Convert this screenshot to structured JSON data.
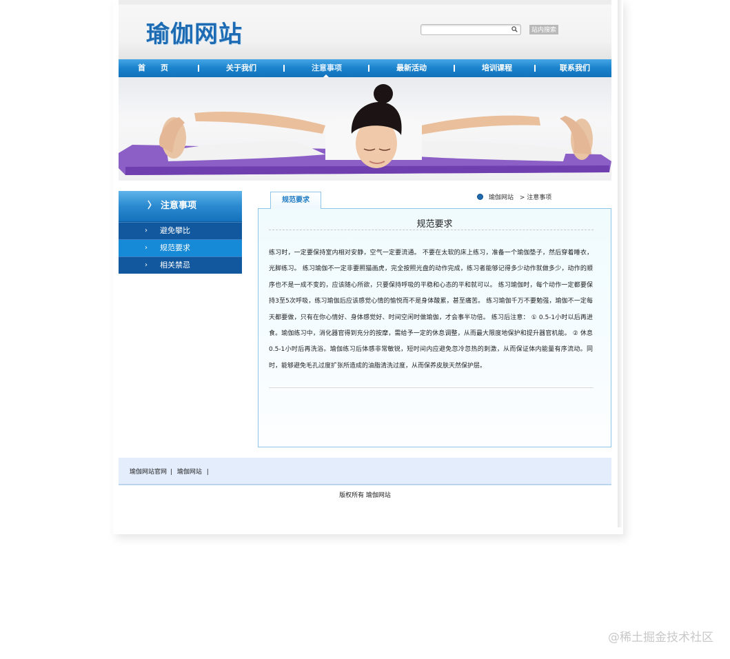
{
  "site": {
    "logo_text": "瑜伽网站",
    "search_placeholder": "",
    "search_button": "站内搜索"
  },
  "nav": {
    "items": [
      {
        "label": "首　　页"
      },
      {
        "label": "关于我们"
      },
      {
        "label": "注意事项"
      },
      {
        "label": "最新活动"
      },
      {
        "label": "培训课程"
      },
      {
        "label": "联系我们"
      }
    ],
    "separator": "|",
    "active_index": 2
  },
  "sidebar": {
    "title": "注意事项",
    "title_chevron": "〉",
    "items": [
      {
        "label": "避免攀比",
        "active": false
      },
      {
        "label": "规范要求",
        "active": true
      },
      {
        "label": "相关禁忌",
        "active": false
      }
    ]
  },
  "main": {
    "tab_label": "规范要求",
    "breadcrumb": {
      "home": "瑜伽网站",
      "current": "> 注意事项"
    },
    "title": "规范要求",
    "article": "练习时，一定要保持室内相对安静，空气一定要流通。 不要在太软的床上练习，准备一个瑜伽垫子，然后穿着睡衣，光脚练习。 练习瑜伽不一定非要照猫画虎，完全按照光盘的动作完成，练习者能够记得多少动作就做多少，动作的顺序也不是一成不变的，应该随心所欲，只要保持呼吸的平稳和心态的平和就可以。 练习瑜伽时，每个动作一定都要保持3至5次呼吸，练习瑜伽后应该感觉心情的愉悦而不是身体酸累，甚至痛苦。 练习瑜伽千万不要勉强，瑜伽不一定每天都要做，只有在你心情好、身体感觉好、时间空闲时做瑜伽，才会事半功倍。 练习后注意： ① 0.5-1小时以后再进食。瑜伽练习中，消化器官得到充分的按摩，需给予一定的休息调整，从而最大限度地保护和提升器官机能。 ② 休息0.5-1小时后再洗浴。瑜伽练习后体感非常敏锐，短时间内应避免忽冷忽热的刺激，从而保证体内能量有序流动。同时，能够避免毛孔过度扩张所造成的油脂清洗过度，从而保养皮肤天然保护层。"
  },
  "footer": {
    "links": [
      {
        "label": "瑜伽网站官网"
      },
      {
        "label": "瑜伽网站"
      }
    ],
    "separator": "|",
    "copyright": "版权所有 瑜伽网站"
  },
  "watermark": "@稀土掘金技术社区",
  "colors": {
    "nav_blue": "#1a82cc",
    "sidebar_dark": "#12589f",
    "sidebar_active": "#1689d7",
    "logo_blue": "#1d6cb3",
    "content_border": "#8ec4e6"
  }
}
